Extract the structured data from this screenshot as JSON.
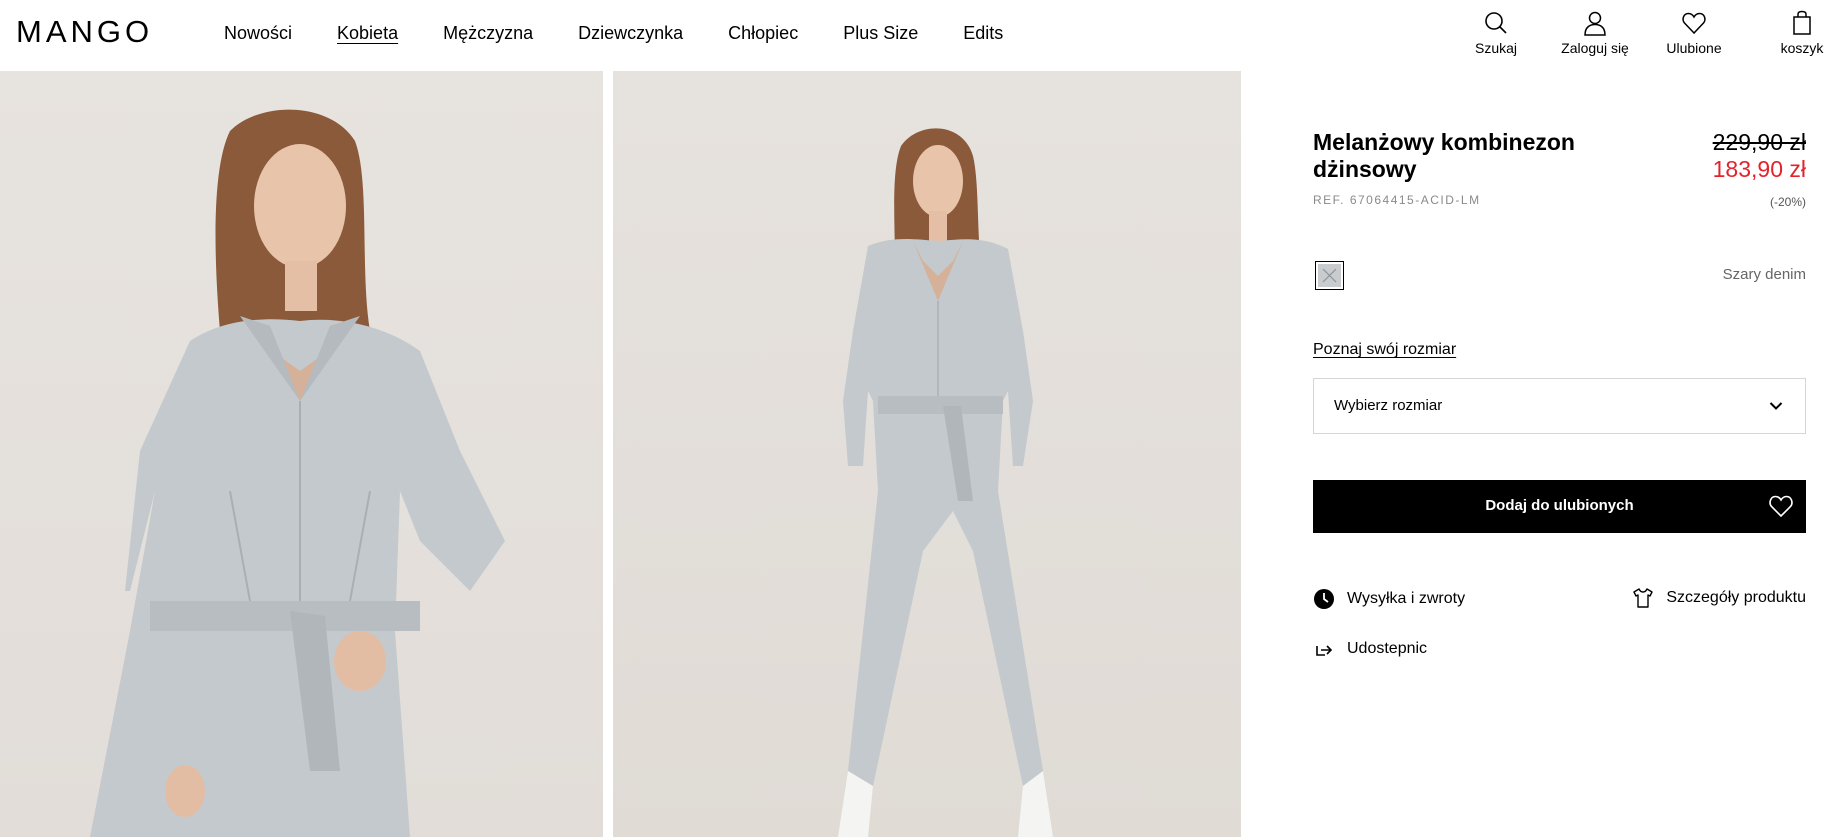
{
  "header": {
    "logo": "MANGO",
    "nav": [
      {
        "label": "Nowości",
        "active": false
      },
      {
        "label": "Kobieta",
        "active": true
      },
      {
        "label": "Mężczyzna",
        "active": false
      },
      {
        "label": "Dziewczynka",
        "active": false
      },
      {
        "label": "Chłopiec",
        "active": false
      },
      {
        "label": "Plus Size",
        "active": false
      },
      {
        "label": "Edits",
        "active": false
      }
    ],
    "tools": {
      "search": {
        "label": "Szukaj",
        "icon": "search-icon"
      },
      "login": {
        "label": "Zaloguj się",
        "icon": "user-icon"
      },
      "favorites": {
        "label": "Ulubione",
        "icon": "heart-icon"
      },
      "cart": {
        "label": "koszyk",
        "icon": "bag-icon"
      }
    }
  },
  "product": {
    "title": "Melanżowy kombinezon dżinsowy",
    "ref": "REF. 67064415-ACID-LM",
    "price_old": "229,90 zł",
    "price_new": "183,90 zł",
    "discount": "(-20%)",
    "color_name": "Szary denim",
    "size_guide": "Poznaj swój rozmiar",
    "size_select": "Wybierz rozmiar",
    "add_favorite": "Dodaj do ulubionych",
    "links": {
      "shipping": "Wysyłka i zwroty",
      "details": "Szczegóły produktu",
      "share": "Udostepnic"
    }
  },
  "colors": {
    "accent_price": "#e3232b",
    "button_bg": "#000000",
    "denim": "#c4c9cd"
  }
}
